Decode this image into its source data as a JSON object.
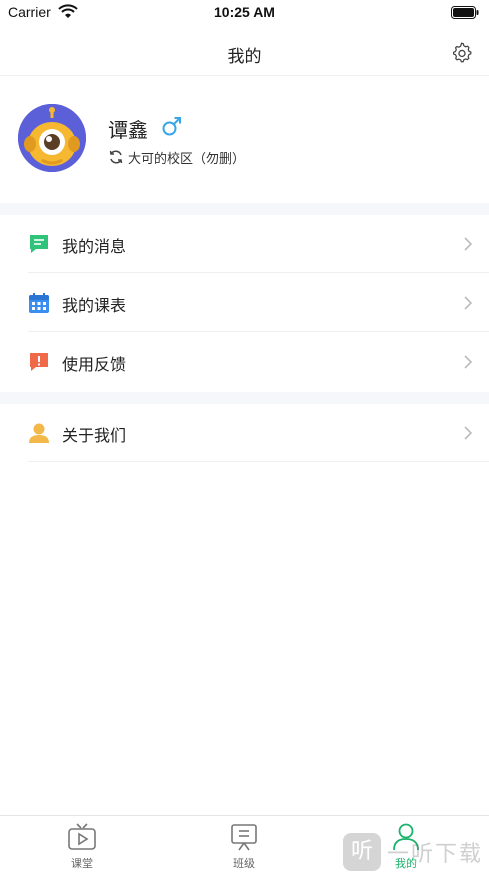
{
  "status_bar": {
    "carrier": "Carrier",
    "time": "10:25 AM"
  },
  "nav": {
    "title": "我的"
  },
  "profile": {
    "name": "谭鑫",
    "campus": "大可的校区（勿删）"
  },
  "menu": {
    "items": [
      {
        "label": "我的消息",
        "icon": "message-icon"
      },
      {
        "label": "我的课表",
        "icon": "calendar-icon"
      },
      {
        "label": "使用反馈",
        "icon": "feedback-icon"
      },
      {
        "label": "关于我们",
        "icon": "person-icon"
      }
    ]
  },
  "tabbar": {
    "tabs": [
      {
        "label": "课堂"
      },
      {
        "label": "班级"
      },
      {
        "label": "我的"
      }
    ]
  },
  "colors": {
    "accent": "#1bb36b",
    "message": "#2fc47a",
    "calendar": "#3a8ef0",
    "feedback": "#f06a4a",
    "person": "#f3b84a"
  }
}
